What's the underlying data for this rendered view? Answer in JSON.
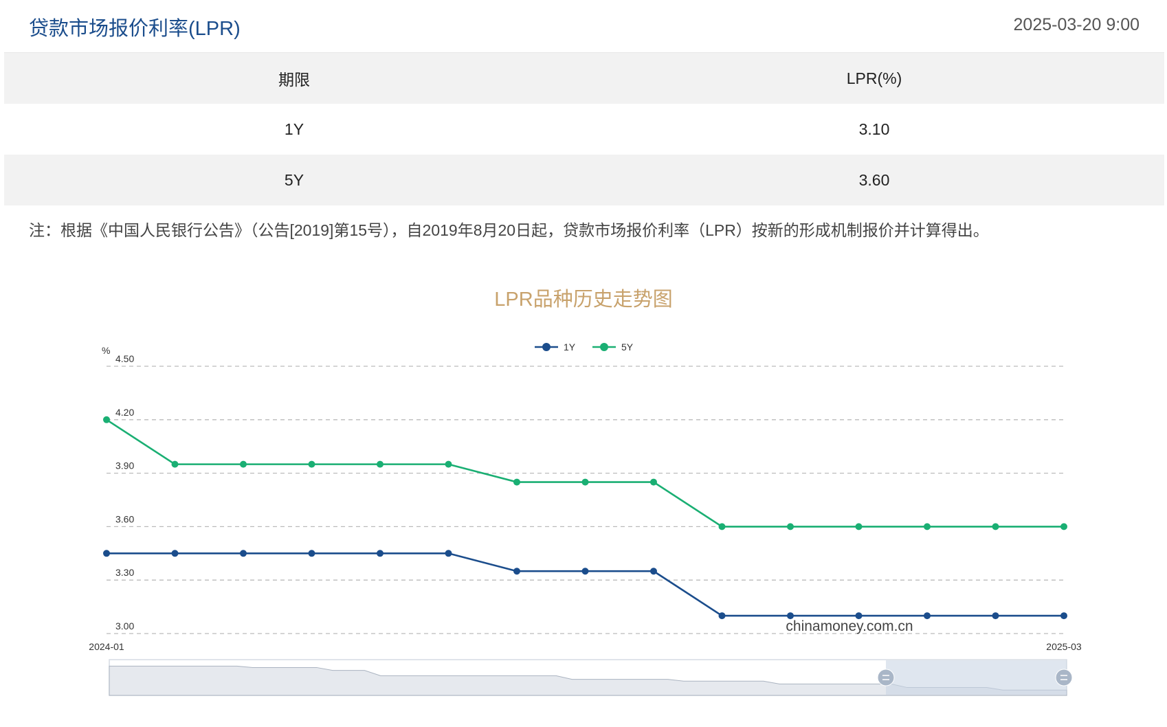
{
  "header": {
    "title": "贷款市场报价利率(LPR)",
    "date": "2025-03-20 9:00"
  },
  "table": {
    "columns": [
      "期限",
      "LPR(%)"
    ],
    "rows": [
      {
        "term": "1Y",
        "rate": "3.10"
      },
      {
        "term": "5Y",
        "rate": "3.60"
      }
    ]
  },
  "note": "注：根据《中国人民银行公告》（公告[2019]第15号），自2019年8月20日起，贷款市场报价利率（LPR）按新的形成机制报价并计算得出。",
  "watermark": "chinamoney.com.cn",
  "colors": {
    "series_1y": "#1b4d8c",
    "series_5y": "#1aaf73",
    "title": "#c8a26c"
  },
  "chart_data": {
    "type": "line",
    "title": "LPR品种历史走势图",
    "ylabel": "%",
    "ylim": [
      3.0,
      4.5
    ],
    "yticks": [
      "3.00",
      "3.30",
      "3.60",
      "3.90",
      "4.20",
      "4.50"
    ],
    "x": [
      "2024-01",
      "2024-02",
      "2024-03",
      "2024-04",
      "2024-05",
      "2024-06",
      "2024-07",
      "2024-08",
      "2024-09",
      "2024-10",
      "2024-11",
      "2024-12",
      "2025-01",
      "2025-02",
      "2025-03"
    ],
    "x_tick_labels": [
      "2024-01",
      "2025-03"
    ],
    "legend_position": "top-center",
    "grid": true,
    "series": [
      {
        "name": "1Y",
        "color": "#1b4d8c",
        "values": [
          3.45,
          3.45,
          3.45,
          3.45,
          3.45,
          3.45,
          3.35,
          3.35,
          3.35,
          3.1,
          3.1,
          3.1,
          3.1,
          3.1,
          3.1
        ]
      },
      {
        "name": "5Y",
        "color": "#1aaf73",
        "values": [
          4.2,
          3.95,
          3.95,
          3.95,
          3.95,
          3.95,
          3.85,
          3.85,
          3.85,
          3.6,
          3.6,
          3.6,
          3.6,
          3.6,
          3.6
        ]
      }
    ]
  }
}
